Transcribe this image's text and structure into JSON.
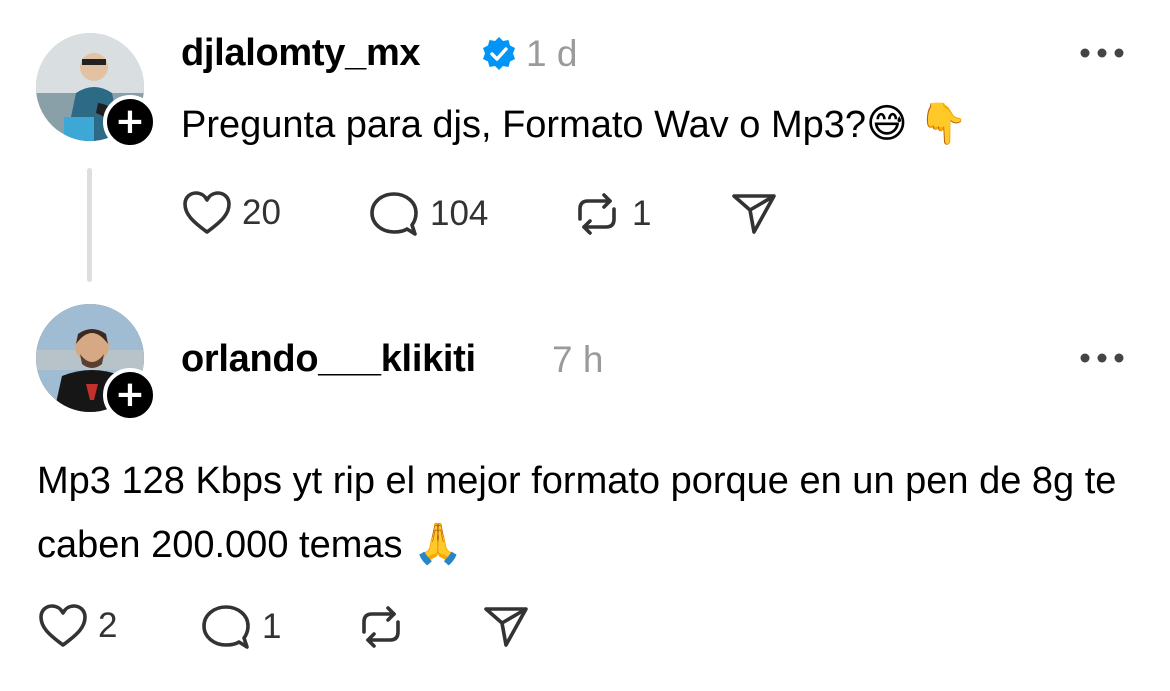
{
  "posts": [
    {
      "username": "djlalomty_mx",
      "verified": true,
      "time": "1 d",
      "text": "Pregunta para djs, Formato Wav o Mp3?",
      "emojis": [
        "😅",
        "👇"
      ],
      "likes": "20",
      "replies": "104",
      "reposts": "1"
    },
    {
      "username": "orlando___klikiti",
      "verified": false,
      "time": "7 h",
      "text": "Mp3 128 Kbps yt rip el mejor formato porque en un pen de 8g te caben 200.000 temas",
      "emojis": [
        "🙏"
      ],
      "likes": "2",
      "replies": "1",
      "reposts": ""
    }
  ],
  "icons": {
    "like": "heart-icon",
    "reply": "comment-icon",
    "repost": "repost-icon",
    "share": "send-icon",
    "more": "more-icon",
    "verified": "verified-badge-icon",
    "follow": "plus-icon"
  },
  "colors": {
    "verified": "#0095f6",
    "time": "#9a9a9a",
    "thread_line": "#dedede"
  }
}
